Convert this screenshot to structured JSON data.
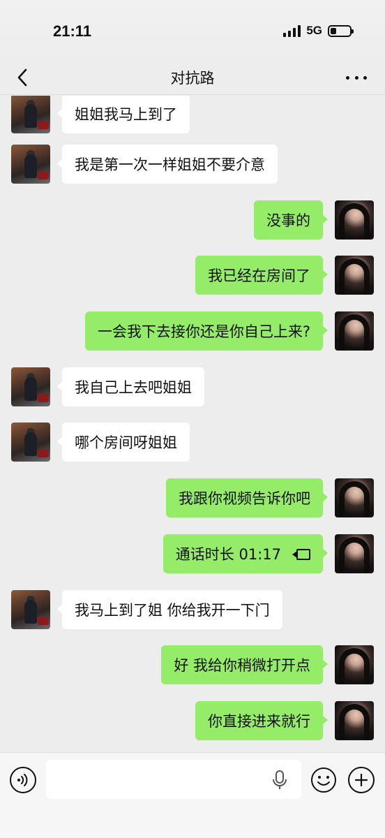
{
  "status_bar": {
    "time": "21:11",
    "network": "5G"
  },
  "nav": {
    "title": "对抗路"
  },
  "messages": [
    {
      "side": "in",
      "text": "姐姐我马上到了"
    },
    {
      "side": "in",
      "text": "我是第一次一样姐姐不要介意"
    },
    {
      "side": "out",
      "text": "没事的"
    },
    {
      "side": "out",
      "text": "我已经在房间了"
    },
    {
      "side": "out",
      "text": "一会我下去接你还是你自己上来?"
    },
    {
      "side": "in",
      "text": "我自己上去吧姐姐"
    },
    {
      "side": "in",
      "text": "哪个房间呀姐姐"
    },
    {
      "side": "out",
      "text": "我跟你视频告诉你吧"
    },
    {
      "side": "out",
      "text": "通话时长 01:17",
      "icon": "video-call-icon"
    },
    {
      "side": "in",
      "text": "我马上到了姐  你给我开一下门"
    },
    {
      "side": "out",
      "text": "好  我给你稍微打开点"
    },
    {
      "side": "out",
      "text": "你直接进来就行"
    }
  ],
  "colors": {
    "incoming_bubble": "#ffffff",
    "outgoing_bubble": "#95ec69",
    "background": "#ededed"
  },
  "input_bar": {
    "value": "",
    "icons": [
      "voice-icon",
      "mic-icon",
      "emoji-icon",
      "plus-icon"
    ]
  }
}
